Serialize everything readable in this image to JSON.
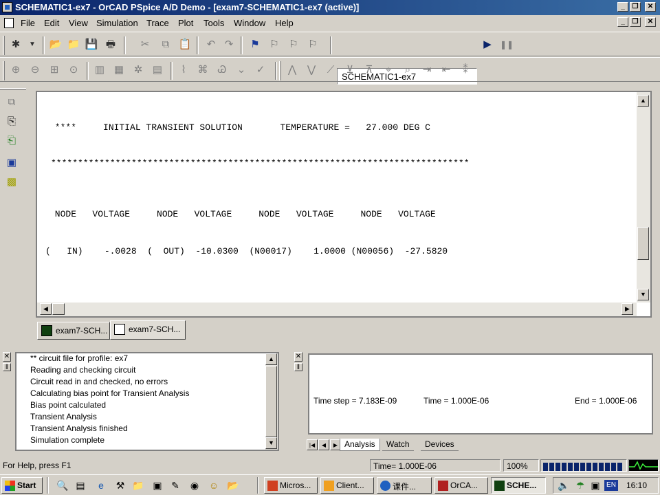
{
  "window": {
    "title": "SCHEMATIC1-ex7 - OrCAD PSpice A/D Demo  - [exam7-SCHEMATIC1-ex7 (active)]"
  },
  "menu": [
    "File",
    "Edit",
    "View",
    "Simulation",
    "Trace",
    "Plot",
    "Tools",
    "Window",
    "Help"
  ],
  "toolbar": {
    "profile_value": "SCHEMATIC1-ex7"
  },
  "output": {
    "line1": " ****     INITIAL TRANSIENT SOLUTION       TEMPERATURE =   27.000 DEG C",
    "line2": "******************************************************************************",
    "line3": " NODE   VOLTAGE     NODE   VOLTAGE     NODE   VOLTAGE     NODE   VOLTAGE",
    "line4": "(   IN)    -.0028  (  OUT)  -10.0300  (N00017)    1.0000 (N00056)  -27.5820"
  },
  "doc_tabs": [
    {
      "label": "exam7-SCH..."
    },
    {
      "label": "exam7-SCH..."
    }
  ],
  "log": [
    "** circuit file for profile: ex7",
    "Reading and checking circuit",
    "Circuit read in and checked, no errors",
    "Calculating bias point for Transient Analysis",
    "Bias point calculated",
    "Transient Analysis",
    "Transient Analysis finished",
    "Simulation complete"
  ],
  "progress": {
    "time_step": "Time step =  7.183E-09",
    "time": "Time =  1.000E-06",
    "end": "End =  1.000E-06",
    "tabs": [
      "Analysis",
      "Watch",
      "Devices"
    ]
  },
  "status": {
    "help": "For Help, press F1",
    "time": "Time= 1.000E-06",
    "percent": "100%",
    "progress_fraction": 1.0
  },
  "taskbar": {
    "start": "Start",
    "tasks": [
      "Micros...",
      "Client...",
      "课件...",
      "OrCA...",
      "SCHE..."
    ],
    "lang": "EN",
    "clock": "16:10"
  }
}
